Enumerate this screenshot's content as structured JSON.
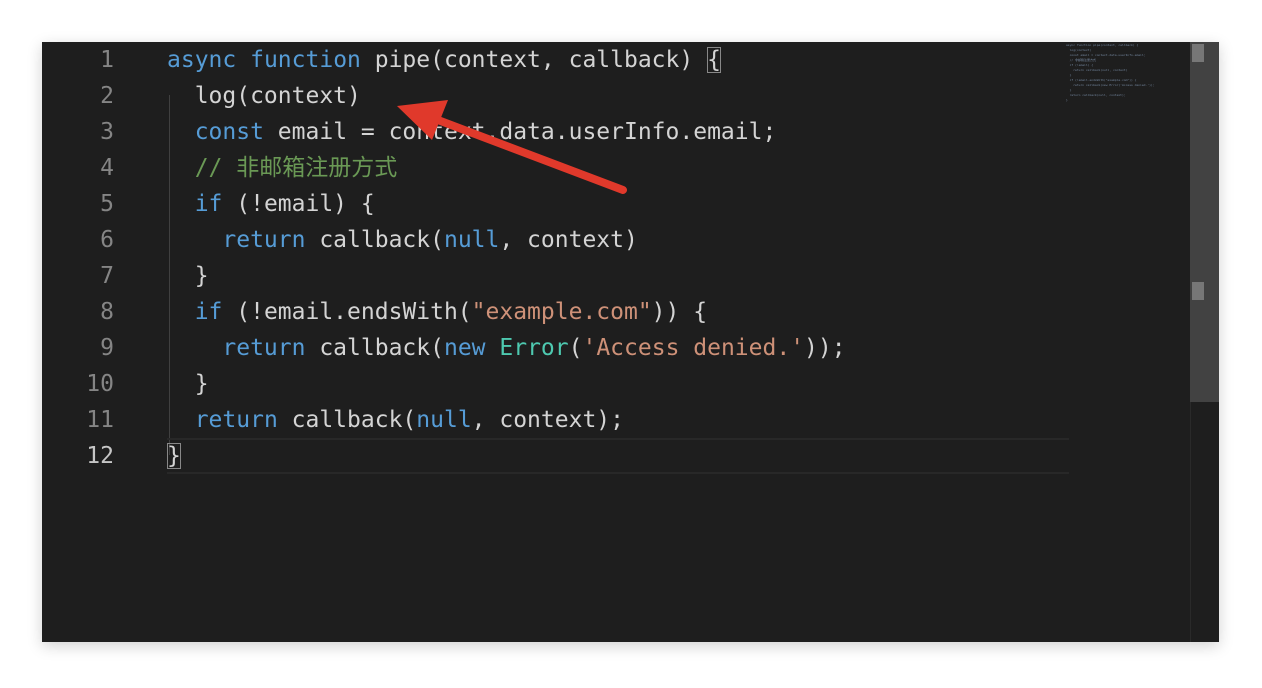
{
  "editor": {
    "line_numbers": [
      "1",
      "2",
      "3",
      "4",
      "5",
      "6",
      "7",
      "8",
      "9",
      "10",
      "11",
      "12"
    ],
    "active_line": "12",
    "lines": [
      [
        [
          "async",
          "kw"
        ],
        [
          " ",
          "plain"
        ],
        [
          "function",
          "kw"
        ],
        [
          " pipe(context, callback) ",
          "plain"
        ],
        [
          "{",
          "bracket"
        ]
      ],
      [
        [
          "  log(context)",
          "plain"
        ]
      ],
      [
        [
          "  ",
          "plain"
        ],
        [
          "const",
          "kw"
        ],
        [
          " email = context.data.userInfo.email;",
          "plain"
        ]
      ],
      [
        [
          "  // 非邮箱注册方式",
          "cmt"
        ]
      ],
      [
        [
          "  ",
          "plain"
        ],
        [
          "if",
          "kw"
        ],
        [
          " (!email) {",
          "plain"
        ]
      ],
      [
        [
          "    ",
          "plain"
        ],
        [
          "return",
          "kw"
        ],
        [
          " callback(",
          "plain"
        ],
        [
          "null",
          "kw"
        ],
        [
          ", context)",
          "plain"
        ]
      ],
      [
        [
          "  }",
          "plain"
        ]
      ],
      [
        [
          "  ",
          "plain"
        ],
        [
          "if",
          "kw"
        ],
        [
          " (!email.endsWith(",
          "plain"
        ],
        [
          "\"example.com\"",
          "str"
        ],
        [
          ")) {",
          "plain"
        ]
      ],
      [
        [
          "    ",
          "plain"
        ],
        [
          "return",
          "kw"
        ],
        [
          " callback(",
          "plain"
        ],
        [
          "new",
          "kw"
        ],
        [
          " ",
          "plain"
        ],
        [
          "Error",
          "cls"
        ],
        [
          "(",
          "plain"
        ],
        [
          "'Access denied.'",
          "str"
        ],
        [
          "));",
          "plain"
        ]
      ],
      [
        [
          "  }",
          "plain"
        ]
      ],
      [
        [
          "  ",
          "plain"
        ],
        [
          "return",
          "kw"
        ],
        [
          " callback(",
          "plain"
        ],
        [
          "null",
          "kw"
        ],
        [
          ", context);",
          "plain"
        ]
      ],
      [
        [
          "}",
          "bracket"
        ]
      ]
    ]
  },
  "minimap": {
    "lines": [
      "async function pipe(context, callback) {",
      "  log(context)",
      "  const email = context.data.userInfo.email;",
      "  // 非邮箱注册方式",
      "  if (!email) {",
      "    return callback(null, context)",
      "  }",
      "  if (!email.endsWith(\"example.com\")) {",
      "    return callback(new Error('Access denied.'));",
      "  }",
      "  return callback(null, context);",
      "}"
    ]
  },
  "annotation": {
    "arrow_color": "#e0392b",
    "icon": "red-arrow-icon"
  },
  "colors": {
    "background": "#1e1e1e",
    "keyword": "#569cd6",
    "string": "#ce9178",
    "comment": "#6a9955",
    "class": "#4ec9b0",
    "text": "#d4d4d4",
    "line_number": "#858585"
  }
}
